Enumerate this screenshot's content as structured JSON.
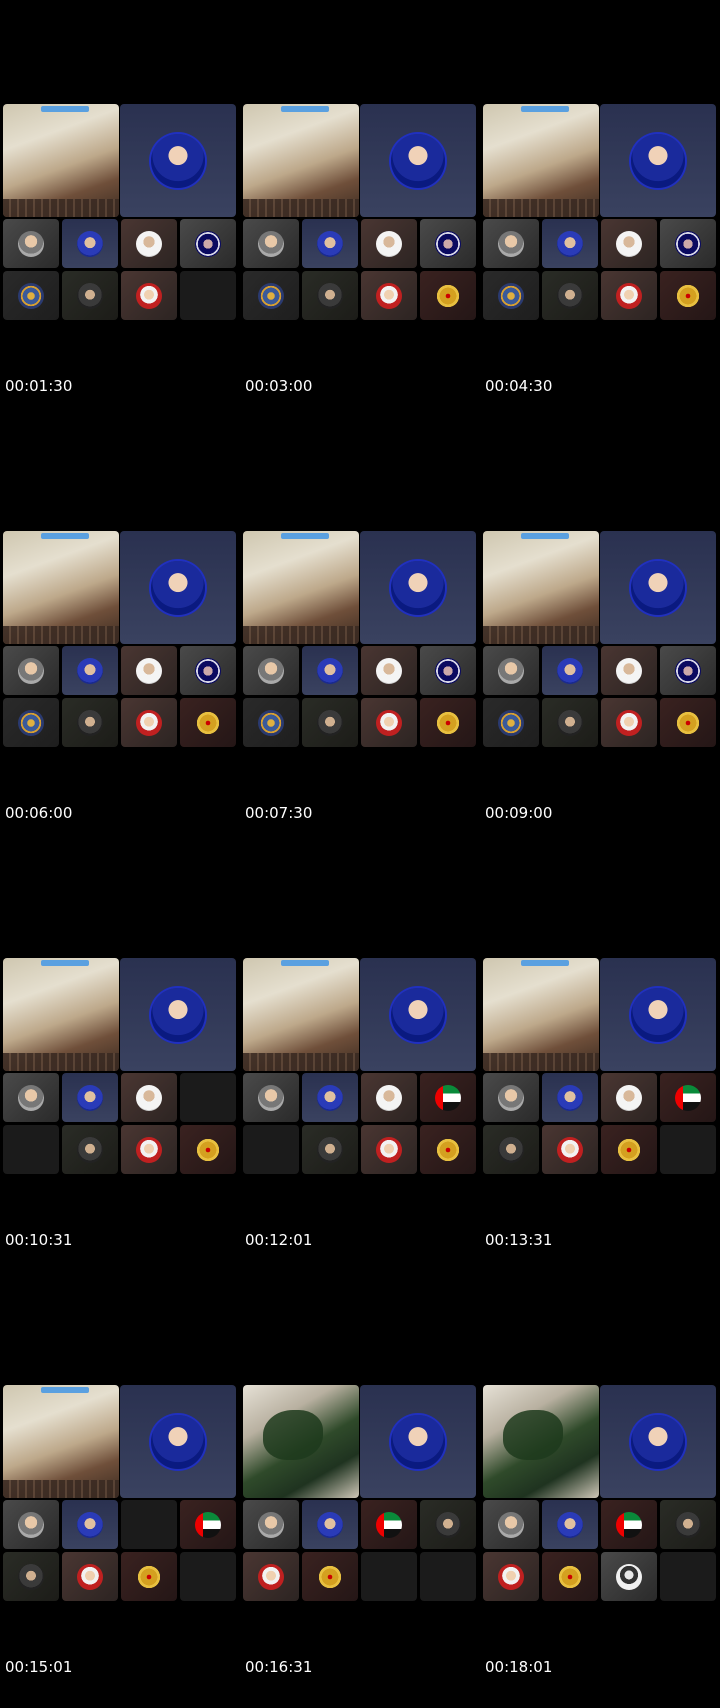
{
  "frames": [
    {
      "time": "00:01:30",
      "share": "map",
      "tiles": [
        "person",
        "blue",
        "white",
        "ring",
        "seal",
        "dim",
        "red",
        "empty"
      ]
    },
    {
      "time": "00:03:00",
      "share": "map",
      "tiles": [
        "person",
        "blue",
        "white",
        "ring",
        "seal",
        "dim",
        "red",
        "eagle"
      ]
    },
    {
      "time": "00:04:30",
      "share": "map",
      "tiles": [
        "person",
        "blue",
        "white",
        "ring",
        "seal",
        "dim",
        "red",
        "eagle"
      ]
    },
    {
      "time": "00:06:00",
      "share": "map",
      "tiles": [
        "person",
        "blue",
        "white",
        "ring",
        "seal",
        "dim",
        "red",
        "eagle"
      ]
    },
    {
      "time": "00:07:30",
      "share": "map",
      "tiles": [
        "person",
        "blue",
        "white",
        "ring",
        "seal",
        "dim",
        "red",
        "eagle"
      ]
    },
    {
      "time": "00:09:00",
      "share": "map",
      "tiles": [
        "person",
        "blue",
        "white",
        "ring",
        "seal",
        "dim",
        "red",
        "eagle"
      ]
    },
    {
      "time": "00:10:31",
      "share": "map",
      "tiles": [
        "person",
        "blue",
        "white",
        "empty",
        "empty",
        "dim",
        "red",
        "eagle"
      ]
    },
    {
      "time": "00:12:01",
      "share": "map",
      "tiles": [
        "person",
        "blue",
        "white",
        "flag",
        "empty",
        "dim",
        "red",
        "eagle"
      ]
    },
    {
      "time": "00:13:31",
      "share": "map",
      "tiles": [
        "person",
        "blue",
        "white",
        "flag",
        "dim",
        "red",
        "eagle",
        "empty"
      ]
    },
    {
      "time": "00:15:01",
      "share": "map",
      "tiles": [
        "person",
        "blue",
        "empty",
        "flag",
        "dim",
        "red",
        "eagle",
        "empty"
      ]
    },
    {
      "time": "00:16:31",
      "share": "plant",
      "tiles": [
        "person",
        "blue",
        "flag",
        "dim",
        "red",
        "eagle",
        "empty",
        "empty"
      ]
    },
    {
      "time": "00:18:01",
      "share": "plant",
      "tiles": [
        "person",
        "blue",
        "flag",
        "dim",
        "red",
        "eagle",
        "woman",
        "empty"
      ]
    }
  ]
}
